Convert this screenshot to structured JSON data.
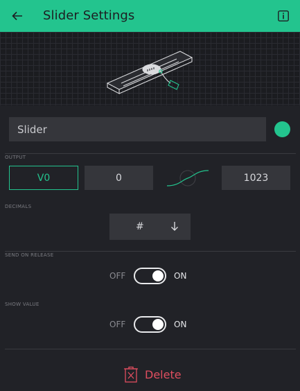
{
  "header": {
    "title": "Slider Settings",
    "back_icon": "arrow-left-icon",
    "info_icon": "info-icon"
  },
  "name": {
    "value": "Slider",
    "color": "#23c48e"
  },
  "output": {
    "label": "OUTPUT",
    "pin": "V0",
    "min": "0",
    "max": "1023"
  },
  "decimals": {
    "label": "DECIMALS",
    "value": "#"
  },
  "send_on_release": {
    "label": "SEND ON RELEASE",
    "off": "OFF",
    "on": "ON",
    "state": "on"
  },
  "show_value": {
    "label": "SHOW VALUE",
    "off": "OFF",
    "on": "ON",
    "state": "on"
  },
  "delete": {
    "label": "Delete",
    "color": "#e04e5f"
  },
  "colors": {
    "accent": "#23c48e",
    "background": "#212227",
    "field": "#35363b"
  }
}
